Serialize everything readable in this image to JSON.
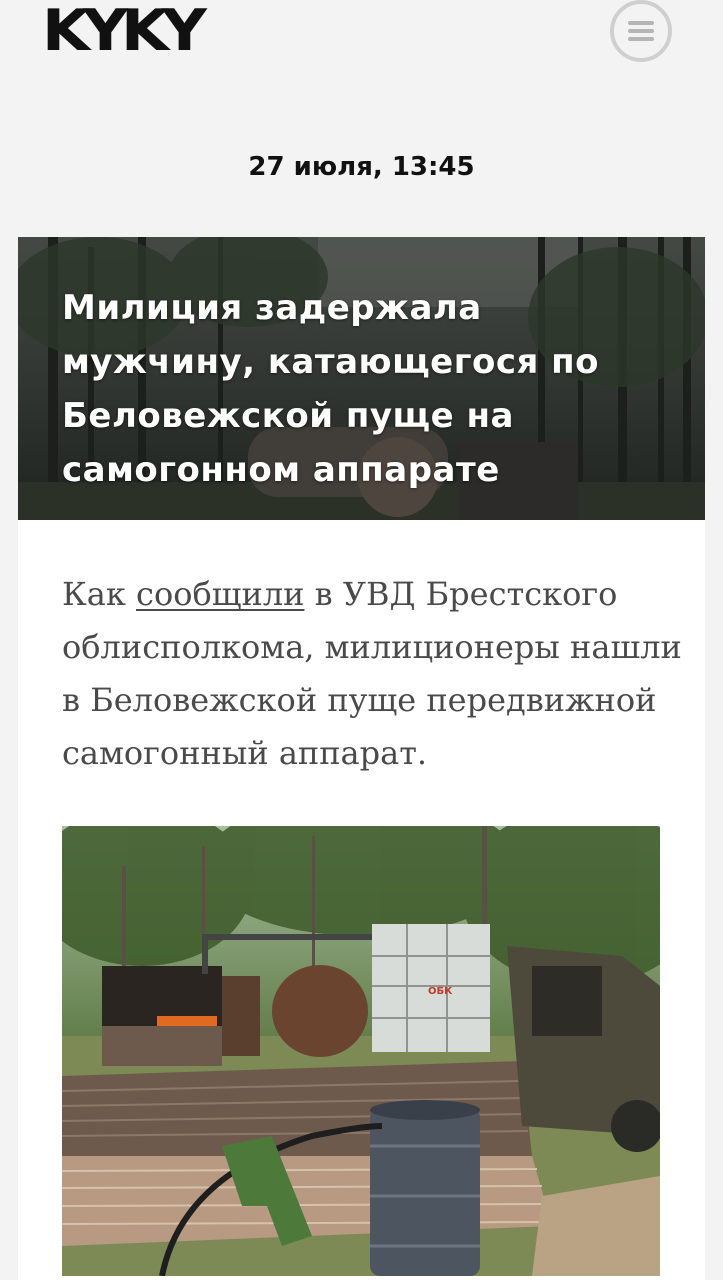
{
  "header": {
    "logo_text": "KYKY",
    "menu_icon": "hamburger-menu-icon"
  },
  "article": {
    "date": "27 июля, 13:45",
    "title": "Милиция задержала мужчину, катающегося по Беловежской пуще на самогонном аппарате",
    "lead": {
      "before_link": "Как ",
      "link_text": "сообщили",
      "after_link": " в УВД Брестского облисполкома, милиционеры нашли в Беловежской пуще передвижной самогонный аппарат."
    },
    "photo_label": "ОБК"
  },
  "colors": {
    "background": "#f3f3f3",
    "card": "#ffffff",
    "text": "#111111",
    "lead_text": "#4a4a4a",
    "menu_ring": "#cfcfcf"
  }
}
